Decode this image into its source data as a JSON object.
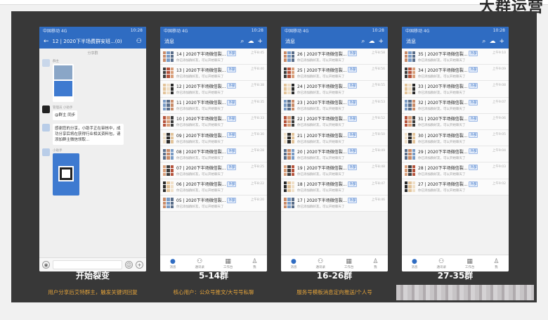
{
  "corner_heading": "大群运营",
  "colors": {
    "accent": "#2f6cc2",
    "caption_text": "#ffffff",
    "subcaption_text": "#e2a23a",
    "slide_bg": "#383838"
  },
  "status_bar": {
    "left": "中国移动 4G",
    "right": "10:28"
  },
  "phone1": {
    "title": "12 | 2020下半场费群安班...(0)",
    "system_line": "分享群",
    "messages": [
      {
        "sender": "群主",
        "text": ""
      },
      {
        "sender": "管理员 小助手",
        "text": "@群主 同步"
      },
      {
        "sender": "",
        "text": "感谢您的分享，小助手正在审核中，成功分享后将在获得行业相关资料包，请添加群主微信领取..."
      },
      {
        "sender": "小助手",
        "text": ""
      }
    ]
  },
  "phone2": {
    "title": "消息",
    "rows": [
      {
        "name": "14 | 2020下半场微信裂...",
        "tag": "外部",
        "sub": "你已添加群好友，可以开始聊天了",
        "time": "上午8:45"
      },
      {
        "name": "13 | 2020下半场微信裂...",
        "tag": "外部",
        "sub": "你已添加群好友，可以开始聊天了",
        "time": "上午8:40"
      },
      {
        "name": "12 | 2020下半场微信裂...",
        "tag": "外部",
        "sub": "你已添加群好友，可以开始聊天了",
        "time": "上午8:38"
      },
      {
        "name": "11 | 2020下半场微信裂...",
        "tag": "外部",
        "sub": "你已添加群好友，可以开始聊天了",
        "time": "上午8:35"
      },
      {
        "name": "10 | 2020下半场微信裂...",
        "tag": "外部",
        "sub": "你已添加群好友，可以开始聊天了",
        "time": "上午8:33"
      },
      {
        "name": "09 | 2020下半场微信裂...",
        "tag": "外部",
        "sub": "你已添加群好友，可以开始聊天了",
        "time": "上午8:30"
      },
      {
        "name": "08 | 2020下半场微信裂...",
        "tag": "外部",
        "sub": "你已添加群好友，可以开始聊天了",
        "time": "上午8:28"
      },
      {
        "name": "07 | 2020下半场微信裂...",
        "tag": "外部",
        "sub": "你已添加群好友，可以开始聊天了",
        "time": "上午8:25"
      },
      {
        "name": "06 | 2020下半场微信裂...",
        "tag": "外部",
        "sub": "你已添加群好友，可以开始聊天了",
        "time": "上午8:22"
      },
      {
        "name": "05 | 2020下半场微信裂...",
        "tag": "外部",
        "sub": "你已添加群好友，可以开始聊天了",
        "time": "上午8:20"
      }
    ]
  },
  "phone3": {
    "title": "消息",
    "rows": [
      {
        "name": "26 | 2020下半场微信裂...",
        "tag": "外部",
        "sub": "你已添加群好友，可以开始聊天了",
        "time": "上午8:58"
      },
      {
        "name": "25 | 2020下半场微信裂...",
        "tag": "外部",
        "sub": "你已添加群好友，可以开始聊天了",
        "time": "上午8:56"
      },
      {
        "name": "24 | 2020下半场微信裂...",
        "tag": "外部",
        "sub": "你已添加群好友，可以开始聊天了",
        "time": "上午8:55"
      },
      {
        "name": "23 | 2020下半场微信裂...",
        "tag": "外部",
        "sub": "你已添加群好友，可以开始聊天了",
        "time": "上午8:53"
      },
      {
        "name": "22 | 2020下半场微信裂...",
        "tag": "外部",
        "sub": "你已添加群好友，可以开始聊天了",
        "time": "上午8:52"
      },
      {
        "name": "21 | 2020下半场微信裂...",
        "tag": "外部",
        "sub": "你已添加群好友，可以开始聊天了",
        "time": "上午8:50"
      },
      {
        "name": "20 | 2020下半场微信裂...",
        "tag": "外部",
        "sub": "你已添加群好友，可以开始聊天了",
        "time": "上午8:49"
      },
      {
        "name": "19 | 2020下半场微信裂...",
        "tag": "外部",
        "sub": "你已添加群好友，可以开始聊天了",
        "time": "上午8:48"
      },
      {
        "name": "18 | 2020下半场微信裂...",
        "tag": "外部",
        "sub": "你已添加群好友，可以开始聊天了",
        "time": "上午8:47"
      },
      {
        "name": "17 | 2020下半场微信裂...",
        "tag": "外部",
        "sub": "你已添加群好友，可以开始聊天了",
        "time": "上午8:46"
      }
    ]
  },
  "phone4": {
    "title": "消息",
    "rows": [
      {
        "name": "35 | 2020下半场微信裂...",
        "tag": "外部",
        "sub": "你已添加群好友，可以开始聊天了",
        "time": "上午9:10"
      },
      {
        "name": "34 | 2020下半场微信裂...",
        "tag": "外部",
        "sub": "你已添加群好友，可以开始聊天了",
        "time": "上午9:09"
      },
      {
        "name": "33 | 2020下半场微信裂...",
        "tag": "外部",
        "sub": "你已添加群好友，可以开始聊天了",
        "time": "上午9:08"
      },
      {
        "name": "32 | 2020下半场微信裂...",
        "tag": "外部",
        "sub": "你已添加群好友，可以开始聊天了",
        "time": "上午9:07"
      },
      {
        "name": "31 | 2020下半场微信裂...",
        "tag": "外部",
        "sub": "你已添加群好友，可以开始聊天了",
        "time": "上午9:06"
      },
      {
        "name": "30 | 2020下半场微信裂...",
        "tag": "外部",
        "sub": "你已添加群好友，可以开始聊天了",
        "time": "上午9:05"
      },
      {
        "name": "29 | 2020下半场微信裂...",
        "tag": "外部",
        "sub": "你已添加群好友，可以开始聊天了",
        "time": "上午9:04"
      },
      {
        "name": "28 | 2020下半场微信裂...",
        "tag": "外部",
        "sub": "你已添加群好友，可以开始聊天了",
        "time": "上午9:03"
      },
      {
        "name": "27 | 2020下半场微信裂...",
        "tag": "外部",
        "sub": "你已添加群好友，可以开始聊天了",
        "time": "上午9:02"
      }
    ]
  },
  "tabs": [
    "消息",
    "通讯录",
    "工作台",
    "我"
  ],
  "captions": [
    {
      "title": "开始裂变",
      "subtitle": "用户分享后艾特群主，触发关键词回复"
    },
    {
      "title": "5-14群",
      "subtitle": "核心用户：公众号推文/大号号私聊"
    },
    {
      "title": "16-26群",
      "subtitle": "服务号模板消息定向推送/个人号"
    },
    {
      "title": "27-35群",
      "subtitle": ""
    }
  ]
}
